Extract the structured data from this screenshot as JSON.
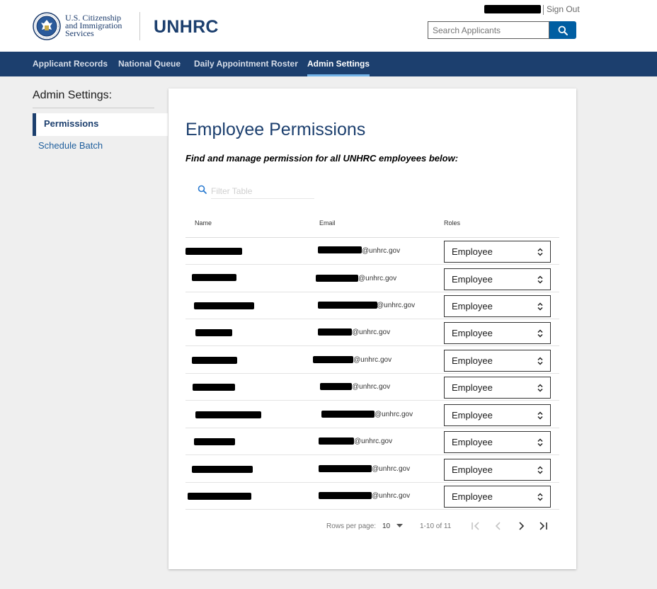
{
  "header": {
    "agency_line1": "U.S. Citizenship",
    "agency_line2": "and Immigration",
    "agency_line3": "Services",
    "app_title": "UNHRC",
    "sign_out": "Sign Out",
    "search_placeholder": "Search Applicants"
  },
  "nav": {
    "items": [
      {
        "label": "Applicant Records"
      },
      {
        "label": "National Queue"
      },
      {
        "label": "Daily Appointment Roster"
      },
      {
        "label": "Admin Settings",
        "active": true
      }
    ]
  },
  "sidebar": {
    "title": "Admin Settings:",
    "items": [
      {
        "label": "Permissions",
        "active": true
      },
      {
        "label": "Schedule Batch"
      }
    ]
  },
  "main": {
    "title": "Employee Permissions",
    "subtitle": "Find and manage permission for all UNHRC employees below:",
    "filter_placeholder": "Filter Table",
    "columns": [
      "Name",
      "Email",
      "Roles"
    ],
    "rows": [
      {
        "email_domain": "@unhrc.gov",
        "role": "Employee"
      },
      {
        "email_domain": "@unhrc.gov",
        "role": "Employee"
      },
      {
        "email_domain": "@unhrc.gov",
        "role": "Employee"
      },
      {
        "email_domain": "@unhrc.gov",
        "role": "Employee"
      },
      {
        "email_domain": "@unhrc.gov",
        "role": "Employee"
      },
      {
        "email_domain": "@unhrc.gov",
        "role": "Employee"
      },
      {
        "email_domain": "@unhrc.gov",
        "role": "Employee"
      },
      {
        "email_domain": "@unhrc.gov",
        "role": "Employee"
      },
      {
        "email_domain": "@unhrc.gov",
        "role": "Employee"
      },
      {
        "email_domain": "@unhrc.gov",
        "role": "Employee"
      }
    ],
    "pagination": {
      "rows_per_page_label": "Rows per page:",
      "rows_per_page": "10",
      "range": "1-10 of 11"
    }
  },
  "colors": {
    "navy": "#1c3f6e",
    "accent_blue": "#005ea2",
    "link_blue": "#1f5f9d"
  }
}
